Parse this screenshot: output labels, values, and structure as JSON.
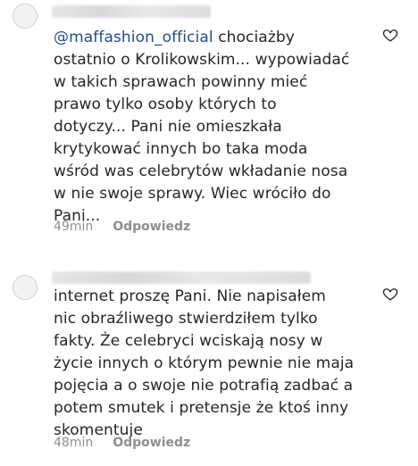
{
  "comments": [
    {
      "mention": "@maffashion_official",
      "lines": [
        " chociażby",
        "ostatnio o Krolikowskim... wypowiadać",
        "w takich sprawach powinny mieć",
        "prawo tylko osoby których to",
        "dotyczy... Pani nie omieszkała",
        "krytykować innych bo taka moda",
        "wśród was celebrytów wkładanie nosa",
        "w nie swoje sprawy. Wiec wróciło do",
        "Pani..."
      ],
      "time": "49min",
      "reply_label": "Odpowiedz",
      "icon": "heart-outline-icon"
    },
    {
      "lines": [
        "internet proszę Pani. Nie napisałem",
        "nic obraźliwego stwierdziłem tylko",
        "fakty. Że celebryci wciskają nosy w",
        "życie innych o którym pewnie nie maja",
        "pojęcia a o swoje nie potrafią zadbać a",
        "potem smutek i pretensje że ktoś inny",
        "skomentuje"
      ],
      "time": "48min",
      "reply_label": "Odpowiedz",
      "icon": "heart-outline-icon"
    }
  ]
}
